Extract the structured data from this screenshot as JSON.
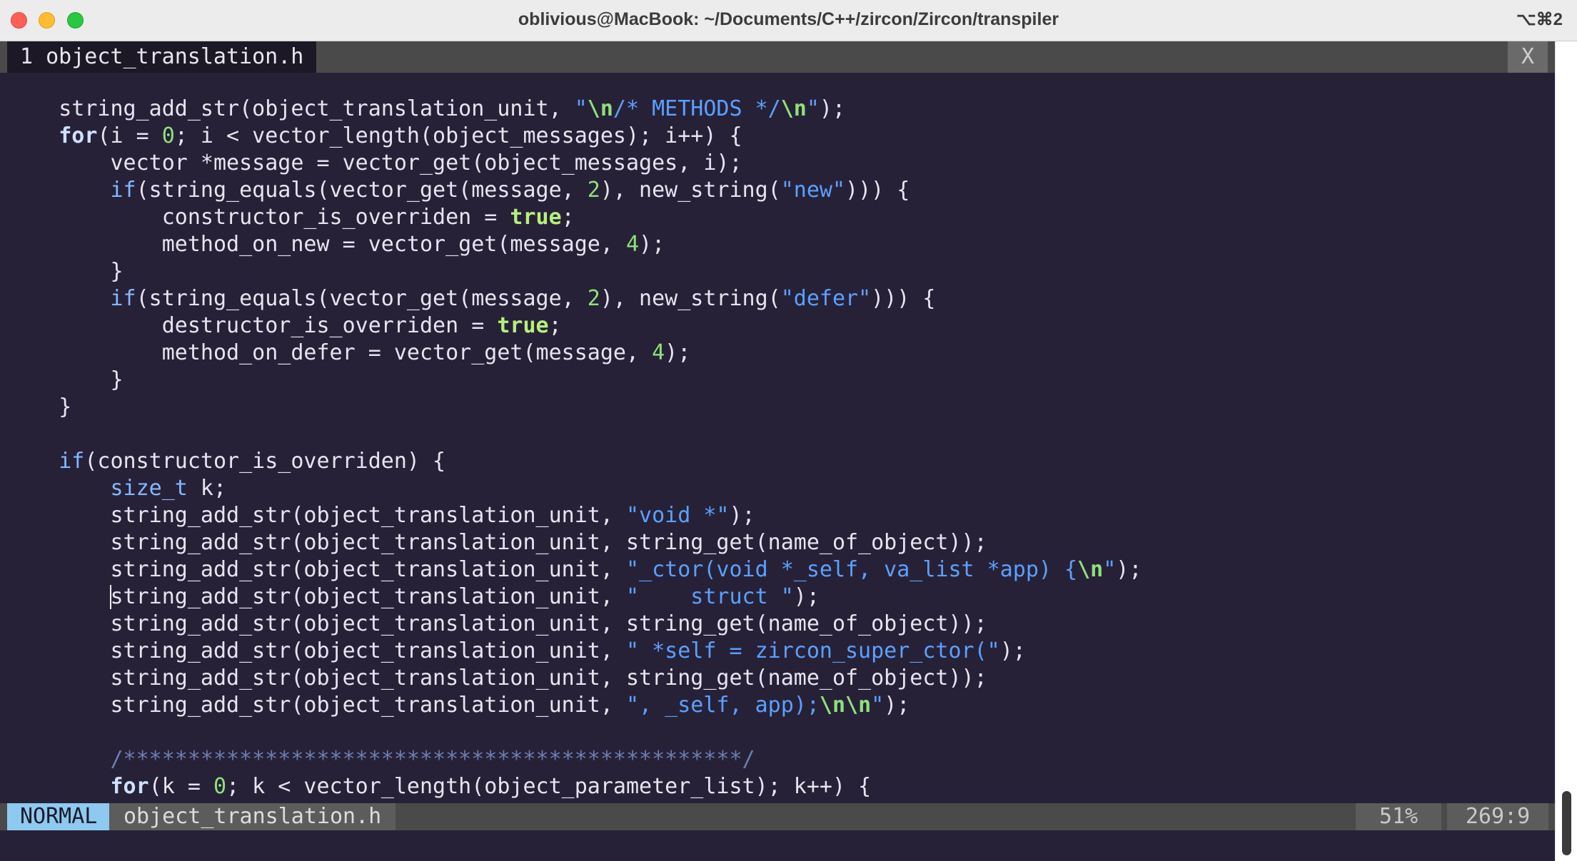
{
  "window": {
    "title": "oblivious@MacBook: ~/Documents/C++/zircon/Zircon/transpiler",
    "shortcut": "⌥⌘2"
  },
  "tabline": {
    "active_tab": "1 object_translation.h",
    "close_label": "X"
  },
  "statusline": {
    "mode": "NORMAL",
    "filename": "object_translation.h",
    "percent": "51%",
    "position": "269:9"
  },
  "code_lines": [
    [
      [
        "t",
        "    string_add_str(object_translation_unit, "
      ],
      [
        "str",
        "\""
      ],
      [
        "esc",
        "\\n"
      ],
      [
        "str",
        "/* METHODS */"
      ],
      [
        "esc",
        "\\n"
      ],
      [
        "str",
        "\""
      ],
      [
        "t",
        ");"
      ]
    ],
    [
      [
        "t",
        "    "
      ],
      [
        "kwb",
        "for"
      ],
      [
        "t",
        "(i = "
      ],
      [
        "num",
        "0"
      ],
      [
        "t",
        "; i < vector_length(object_messages); i++) {"
      ]
    ],
    [
      [
        "t",
        "        vector *message = vector_get(object_messages, i);"
      ]
    ],
    [
      [
        "t",
        "        "
      ],
      [
        "kw",
        "if"
      ],
      [
        "t",
        "(string_equals(vector_get(message, "
      ],
      [
        "num",
        "2"
      ],
      [
        "t",
        "), new_string("
      ],
      [
        "str",
        "\"new\""
      ],
      [
        "t",
        "))) {"
      ]
    ],
    [
      [
        "t",
        "            constructor_is_overriden = "
      ],
      [
        "bool",
        "true"
      ],
      [
        "t",
        ";"
      ]
    ],
    [
      [
        "t",
        "            method_on_new = vector_get(message, "
      ],
      [
        "num",
        "4"
      ],
      [
        "t",
        ");"
      ]
    ],
    [
      [
        "t",
        "        }"
      ]
    ],
    [
      [
        "t",
        "        "
      ],
      [
        "kw",
        "if"
      ],
      [
        "t",
        "(string_equals(vector_get(message, "
      ],
      [
        "num",
        "2"
      ],
      [
        "t",
        "), new_string("
      ],
      [
        "str",
        "\"defer\""
      ],
      [
        "t",
        "))) {"
      ]
    ],
    [
      [
        "t",
        "            destructor_is_overriden = "
      ],
      [
        "bool",
        "true"
      ],
      [
        "t",
        ";"
      ]
    ],
    [
      [
        "t",
        "            method_on_defer = vector_get(message, "
      ],
      [
        "num",
        "4"
      ],
      [
        "t",
        ");"
      ]
    ],
    [
      [
        "t",
        "        }"
      ]
    ],
    [
      [
        "t",
        "    }"
      ]
    ],
    [
      [
        "t",
        ""
      ]
    ],
    [
      [
        "t",
        "    "
      ],
      [
        "kw",
        "if"
      ],
      [
        "t",
        "(constructor_is_overriden) {"
      ]
    ],
    [
      [
        "t",
        "        "
      ],
      [
        "kw",
        "size_t"
      ],
      [
        "t",
        " k;"
      ]
    ],
    [
      [
        "t",
        "        string_add_str(object_translation_unit, "
      ],
      [
        "str",
        "\"void *\""
      ],
      [
        "t",
        ");"
      ]
    ],
    [
      [
        "t",
        "        string_add_str(object_translation_unit, string_get(name_of_object));"
      ]
    ],
    [
      [
        "t",
        "        string_add_str(object_translation_unit, "
      ],
      [
        "str",
        "\"_ctor(void *_self, va_list *app) {"
      ],
      [
        "esc",
        "\\n"
      ],
      [
        "str",
        "\""
      ],
      [
        "t",
        ");"
      ]
    ],
    [
      [
        "t",
        "        string_add_str(object_translation_unit, "
      ],
      [
        "str",
        "\"    struct \""
      ],
      [
        "t",
        ");"
      ]
    ],
    [
      [
        "t",
        "        string_add_str(object_translation_unit, string_get(name_of_object));"
      ]
    ],
    [
      [
        "t",
        "        string_add_str(object_translation_unit, "
      ],
      [
        "str",
        "\" *self = zircon_super_ctor(\""
      ],
      [
        "t",
        ");"
      ]
    ],
    [
      [
        "t",
        "        string_add_str(object_translation_unit, string_get(name_of_object));"
      ]
    ],
    [
      [
        "t",
        "        string_add_str(object_translation_unit, "
      ],
      [
        "str",
        "\", _self, app);"
      ],
      [
        "esc",
        "\\n\\n"
      ],
      [
        "str",
        "\""
      ],
      [
        "t",
        ");"
      ]
    ],
    [
      [
        "t",
        ""
      ]
    ],
    [
      [
        "t",
        "        "
      ],
      [
        "cmt",
        "/************************************************/"
      ]
    ],
    [
      [
        "t",
        "        "
      ],
      [
        "kwb",
        "for"
      ],
      [
        "t",
        "(k = "
      ],
      [
        "num",
        "0"
      ],
      [
        "t",
        "; k < vector_length(object_parameter_list); k++) {"
      ]
    ]
  ]
}
